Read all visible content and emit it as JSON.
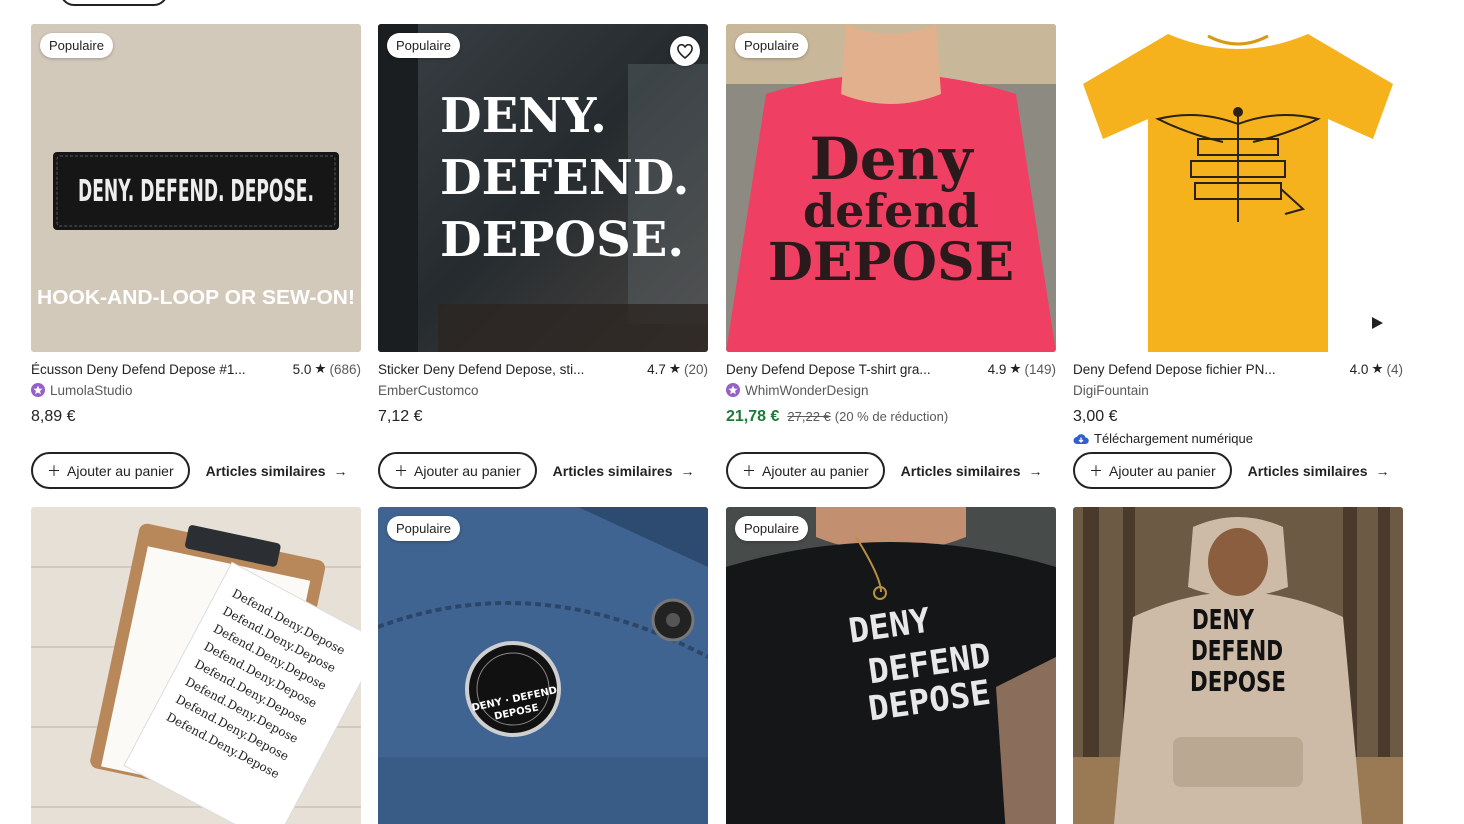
{
  "badge_popular": "Populaire",
  "cart_label": "Ajouter au panier",
  "similar_label": "Articles similaires",
  "colors": {
    "sale_green": "#1d7a39",
    "star_purple": "#9560c8"
  },
  "products": [
    {
      "title": "Écusson Deny Defend Depose #1...",
      "rating": "5.0",
      "reviews": "(686)",
      "shop": "LumolaStudio",
      "star_seller": true,
      "price": "8,89 €",
      "popular": true,
      "image_text": [
        "DENY. DEFEND. DEPOSE.",
        "HOOK-AND-LOOP OR SEW-ON!"
      ]
    },
    {
      "title": "Sticker Deny Defend Depose, sti...",
      "rating": "4.7",
      "reviews": "(20)",
      "shop": "EmberCustomco",
      "star_seller": false,
      "price": "7,12 €",
      "popular": true,
      "favorite_icon": "heart-icon",
      "image_text": [
        "DENY.",
        "DEFEND.",
        "DEPOSE."
      ]
    },
    {
      "title": "Deny Defend Depose T-shirt gra...",
      "rating": "4.9",
      "reviews": "(149)",
      "shop": "WhimWonderDesign",
      "star_seller": true,
      "price": "21,78 €",
      "old_price": "27,22 €",
      "discount": "(20 % de réduction)",
      "popular": true,
      "image_text": [
        "Deny",
        "defend",
        "DEPOSE"
      ]
    },
    {
      "title": "Deny Defend Depose fichier PN...",
      "rating": "4.0",
      "reviews": "(4)",
      "shop": "DigiFountain",
      "star_seller": false,
      "price": "3,00 €",
      "digital_download": "Téléchargement numérique",
      "popular": false,
      "video_icon": "play-icon"
    },
    {
      "popular": false,
      "image_text": [
        "Defend.Deny.Depose"
      ]
    },
    {
      "popular": true,
      "image_text": [
        "DENY · DEFEND",
        "DEPOSE"
      ]
    },
    {
      "popular": true,
      "image_text": [
        "DENY",
        "DEFEND",
        "DEPOSE"
      ]
    },
    {
      "popular": false,
      "image_text": [
        "DENY",
        "DEFEND",
        "DEPOSE"
      ]
    }
  ]
}
